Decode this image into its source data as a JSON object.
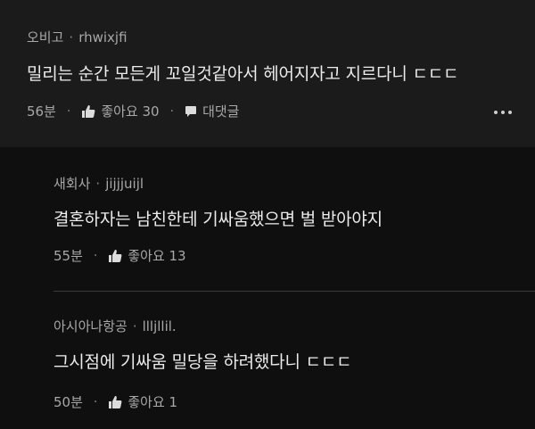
{
  "comments": [
    {
      "author": "오비고",
      "handle": "rhwixjfi",
      "text": "밀리는 순간 모든게 꼬일것같아서 헤어지자고 지르다니 ㄷㄷㄷ",
      "time": "56분",
      "likes_label": "좋아요 30",
      "reply_label": "대댓글"
    }
  ],
  "replies": [
    {
      "author": "새회사",
      "handle": "jijjjuijl",
      "text": "결혼하자는 남친한테 기싸움했으면 벌 받아야지",
      "time": "55분",
      "likes_label": "좋아요 13"
    },
    {
      "author": "아시아나항공",
      "handle": "llljllil.",
      "text": "그시점에 기싸움 밀당을 하려했다니 ㄷㄷㄷ",
      "time": "50분",
      "likes_label": "좋아요 1"
    }
  ],
  "separator": "·",
  "colors": {
    "top_bg": "#1b1b1b",
    "page_bg": "#0f0f0f",
    "text": "#ececec",
    "meta": "#a8a8a8"
  },
  "icons": {
    "like": "thumbs-up-icon",
    "reply": "speech-bubble-icon",
    "more": "more-dots-icon"
  }
}
